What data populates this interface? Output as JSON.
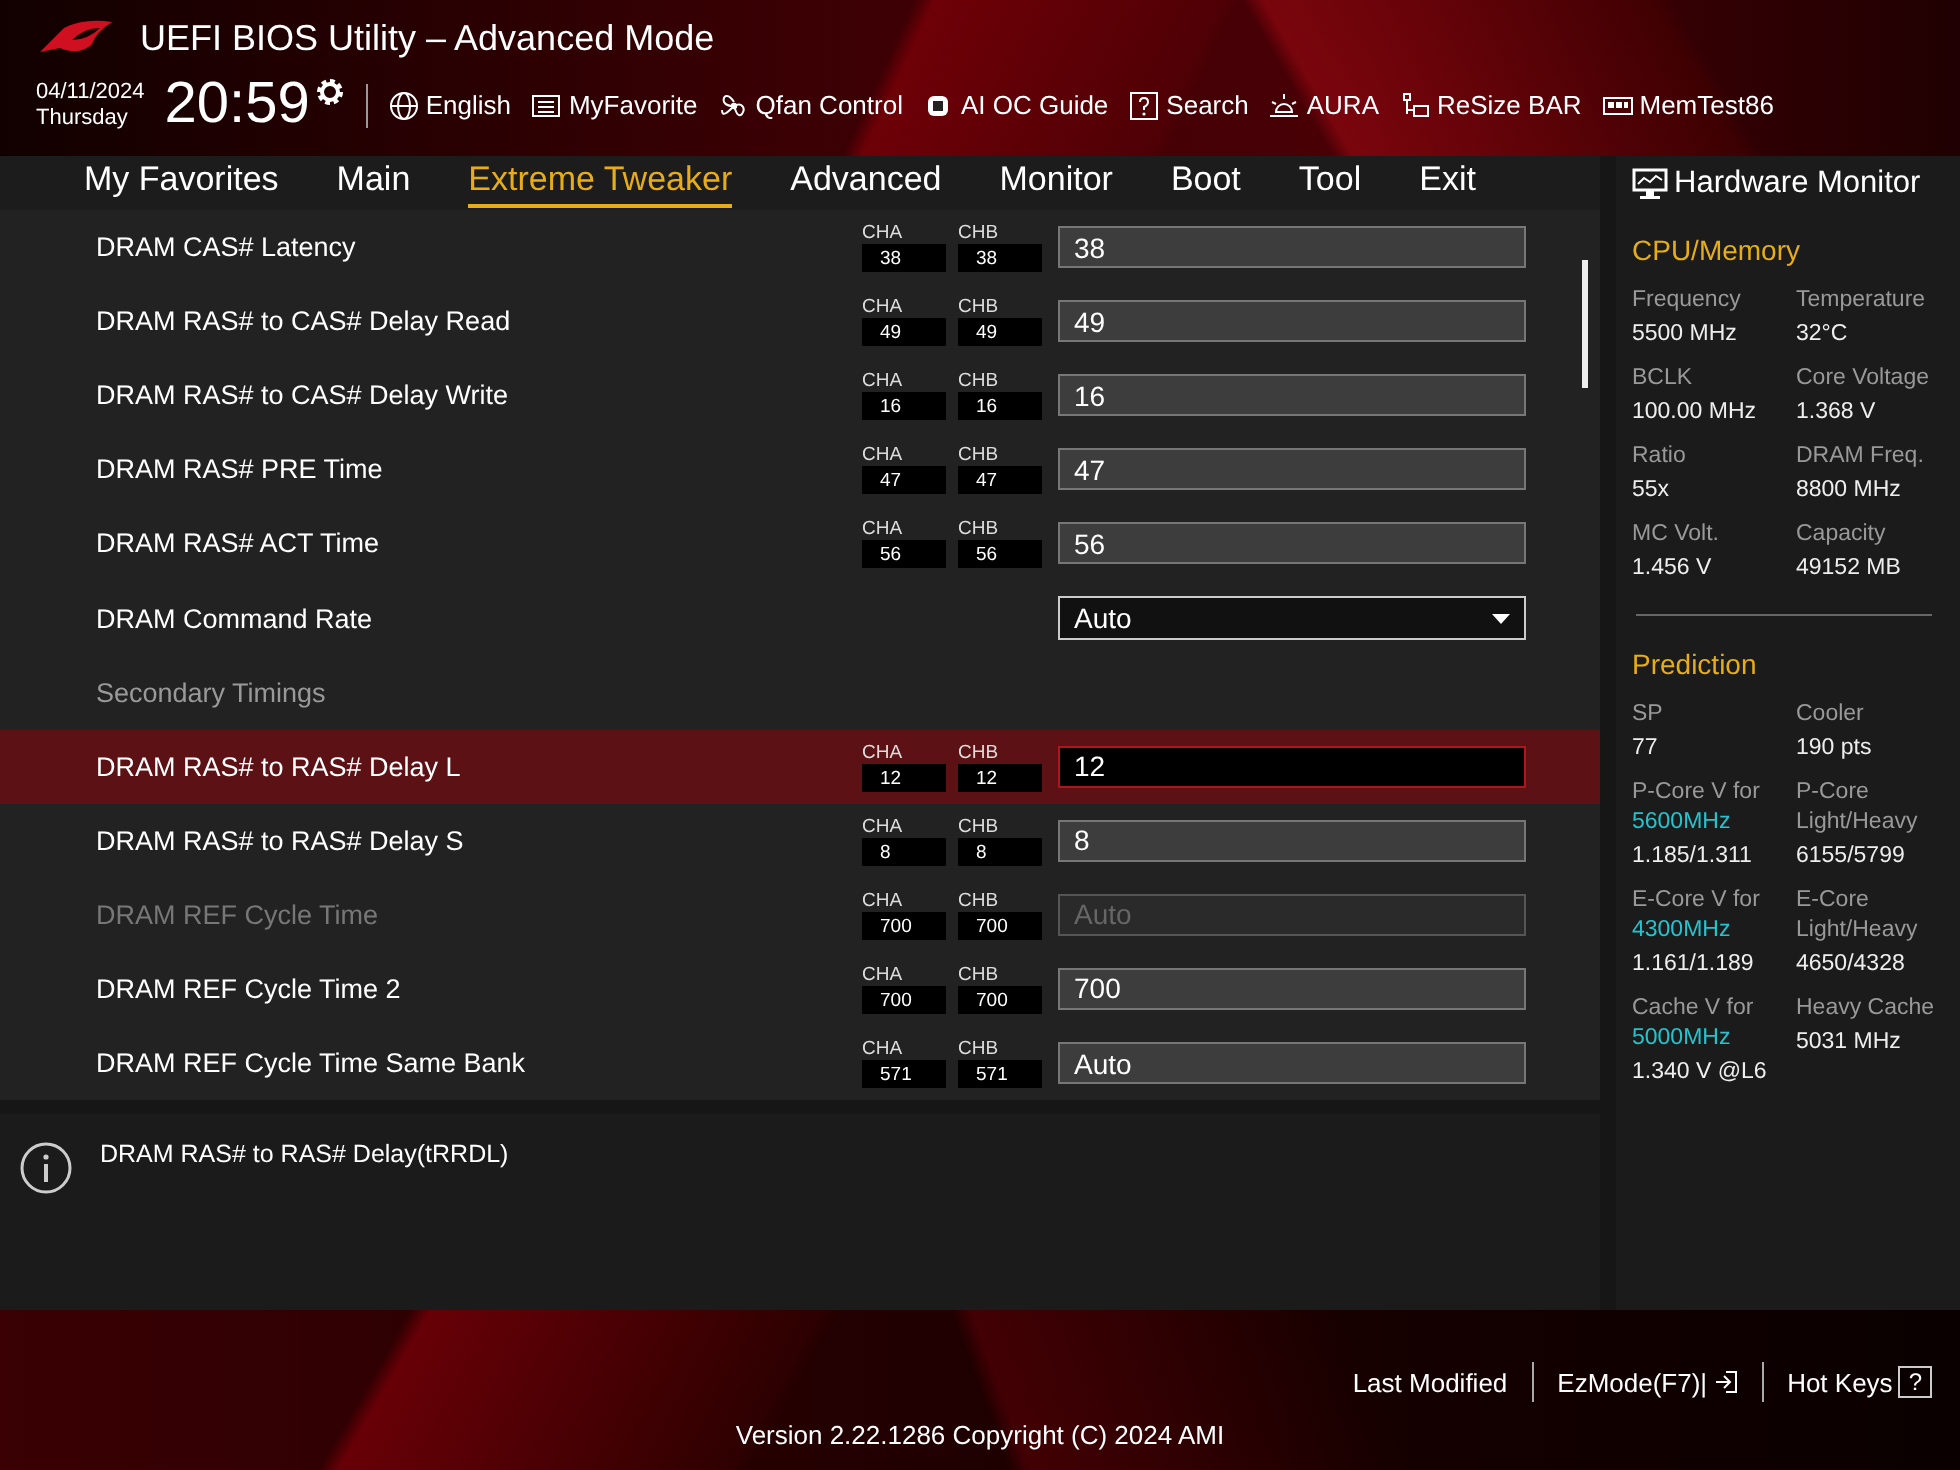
{
  "window": {
    "title": "UEFI BIOS Utility – Advanced Mode"
  },
  "clock": {
    "date": "04/11/2024",
    "day": "Thursday",
    "time": "20:59"
  },
  "toolbar": [
    "English",
    "MyFavorite",
    "Qfan Control",
    "AI OC Guide",
    "Search",
    "AURA",
    "ReSize BAR",
    "MemTest86"
  ],
  "tabs": [
    {
      "label": "My Favorites",
      "selected": false
    },
    {
      "label": "Main",
      "selected": false
    },
    {
      "label": "Extreme Tweaker",
      "selected": true
    },
    {
      "label": "Advanced",
      "selected": false
    },
    {
      "label": "Monitor",
      "selected": false
    },
    {
      "label": "Boot",
      "selected": false
    },
    {
      "label": "Tool",
      "selected": false
    },
    {
      "label": "Exit",
      "selected": false
    }
  ],
  "settings": [
    {
      "kind": "timing",
      "label": "DRAM CAS# Latency",
      "cha_label": "CHA",
      "cha": "38",
      "chb_label": "CHB",
      "chb": "38",
      "value": "38",
      "selected": false,
      "disabled": false
    },
    {
      "kind": "timing",
      "label": "DRAM RAS# to CAS# Delay Read",
      "cha_label": "CHA",
      "cha": "49",
      "chb_label": "CHB",
      "chb": "49",
      "value": "49",
      "selected": false,
      "disabled": false
    },
    {
      "kind": "timing",
      "label": "DRAM RAS# to CAS# Delay Write",
      "cha_label": "CHA",
      "cha": "16",
      "chb_label": "CHB",
      "chb": "16",
      "value": "16",
      "selected": false,
      "disabled": false
    },
    {
      "kind": "timing",
      "label": "DRAM RAS# PRE Time",
      "cha_label": "CHA",
      "cha": "47",
      "chb_label": "CHB",
      "chb": "47",
      "value": "47",
      "selected": false,
      "disabled": false
    },
    {
      "kind": "timing",
      "label": "DRAM RAS# ACT Time",
      "cha_label": "CHA",
      "cha": "56",
      "chb_label": "CHB",
      "chb": "56",
      "value": "56",
      "selected": false,
      "disabled": false
    },
    {
      "kind": "dropdown",
      "label": "DRAM Command Rate",
      "value": "Auto",
      "selected": false,
      "disabled": false
    },
    {
      "kind": "heading",
      "label": "Secondary Timings"
    },
    {
      "kind": "timing",
      "label": "DRAM RAS# to RAS# Delay L",
      "cha_label": "CHA",
      "cha": "12",
      "chb_label": "CHB",
      "chb": "12",
      "value": "12",
      "selected": true,
      "disabled": false
    },
    {
      "kind": "timing",
      "label": "DRAM RAS# to RAS# Delay S",
      "cha_label": "CHA",
      "cha": "8",
      "chb_label": "CHB",
      "chb": "8",
      "value": "8",
      "selected": false,
      "disabled": false
    },
    {
      "kind": "timing",
      "label": "DRAM REF Cycle Time",
      "cha_label": "CHA",
      "cha": "700",
      "chb_label": "CHB",
      "chb": "700",
      "value": "Auto",
      "selected": false,
      "disabled": true
    },
    {
      "kind": "timing",
      "label": "DRAM REF Cycle Time 2",
      "cha_label": "CHA",
      "cha": "700",
      "chb_label": "CHB",
      "chb": "700",
      "value": "700",
      "selected": false,
      "disabled": false
    },
    {
      "kind": "timing",
      "label": "DRAM REF Cycle Time Same Bank",
      "cha_label": "CHA",
      "cha": "571",
      "chb_label": "CHB",
      "chb": "571",
      "value": "Auto",
      "selected": false,
      "disabled": false
    }
  ],
  "help": {
    "text": "DRAM RAS# to RAS# Delay(tRRDL)"
  },
  "hardware_monitor": {
    "title": "Hardware Monitor",
    "sections": [
      {
        "title": "CPU/Memory",
        "items": [
          {
            "label": "Frequency",
            "value": "5500 MHz"
          },
          {
            "label": "Temperature",
            "value": "32°C"
          },
          {
            "label": "BCLK",
            "value": "100.00 MHz"
          },
          {
            "label": "Core Voltage",
            "value": "1.368 V"
          },
          {
            "label": "Ratio",
            "value": "55x"
          },
          {
            "label": "DRAM Freq.",
            "value": "8800 MHz"
          },
          {
            "label": "MC Volt.",
            "value": "1.456 V"
          },
          {
            "label": "Capacity",
            "value": "49152 MB"
          }
        ]
      },
      {
        "title": "Prediction",
        "items": [
          {
            "label": "SP",
            "value": "77"
          },
          {
            "label": "Cooler",
            "value": "190 pts"
          },
          {
            "label": "P-Core V for",
            "freq": "5600MHz",
            "value": "1.185/1.311"
          },
          {
            "label": "P-Core Light/Heavy",
            "value": "6155/5799"
          },
          {
            "label": "E-Core V for",
            "freq": "4300MHz",
            "value": "1.161/1.189"
          },
          {
            "label": "E-Core Light/Heavy",
            "value": "4650/4328"
          },
          {
            "label": "Cache V for",
            "freq": "5000MHz",
            "value": "1.340 V @L6"
          },
          {
            "label": "Heavy Cache",
            "value": "5031 MHz"
          }
        ]
      }
    ]
  },
  "footer": {
    "last_modified": "Last Modified",
    "ezmode": "EzMode(F7)|",
    "hotkeys": "Hot Keys",
    "hotkeys_key": "?",
    "version": "Version 2.22.1286 Copyright (C) 2024 AMI"
  }
}
